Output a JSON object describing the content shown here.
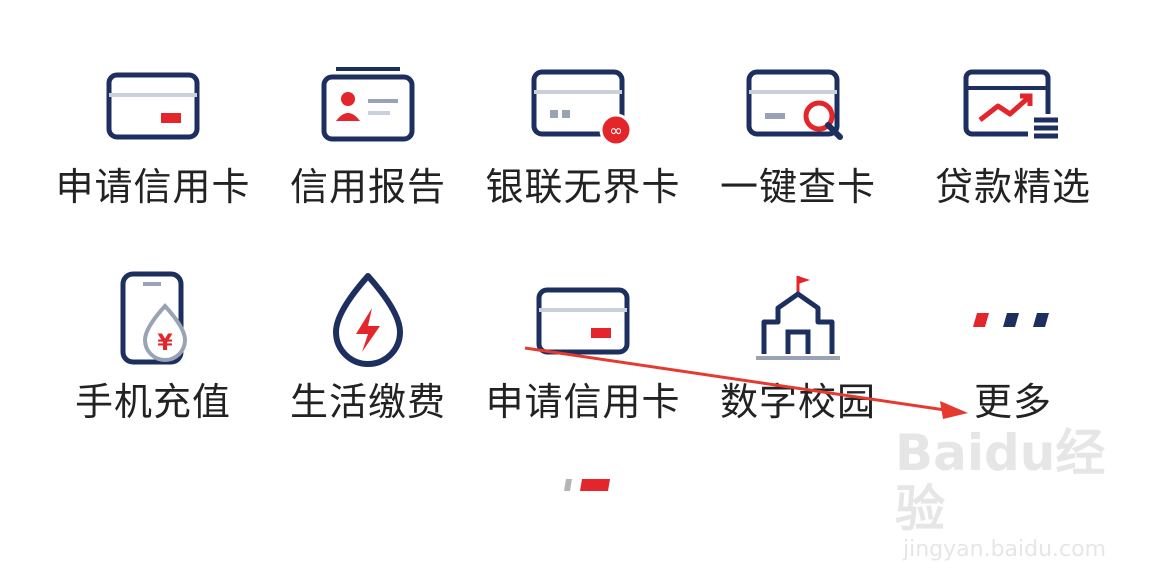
{
  "menu": {
    "row1": [
      {
        "label": "申请信用卡",
        "icon": "credit-card-icon"
      },
      {
        "label": "信用报告",
        "icon": "id-card-icon"
      },
      {
        "label": "银联无界卡",
        "icon": "unionpay-card-icon"
      },
      {
        "label": "一键查卡",
        "icon": "card-search-icon"
      },
      {
        "label": "贷款精选",
        "icon": "loan-chart-icon"
      }
    ],
    "row2": [
      {
        "label": "手机充值",
        "icon": "phone-recharge-icon"
      },
      {
        "label": "生活缴费",
        "icon": "utility-payment-icon"
      },
      {
        "label": "申请信用卡",
        "icon": "credit-card-icon"
      },
      {
        "label": "数字校园",
        "icon": "campus-icon"
      },
      {
        "label": "更多",
        "icon": "more-icon"
      }
    ]
  },
  "pager": {
    "pages": 2,
    "active": 2
  },
  "watermark": {
    "logo": "Baidu经验",
    "url": "jingyan.baidu.com"
  },
  "colors": {
    "navy": "#1c2f5e",
    "red": "#e3262b",
    "grey": "#9aa3b5",
    "light": "#c9cfdb"
  }
}
